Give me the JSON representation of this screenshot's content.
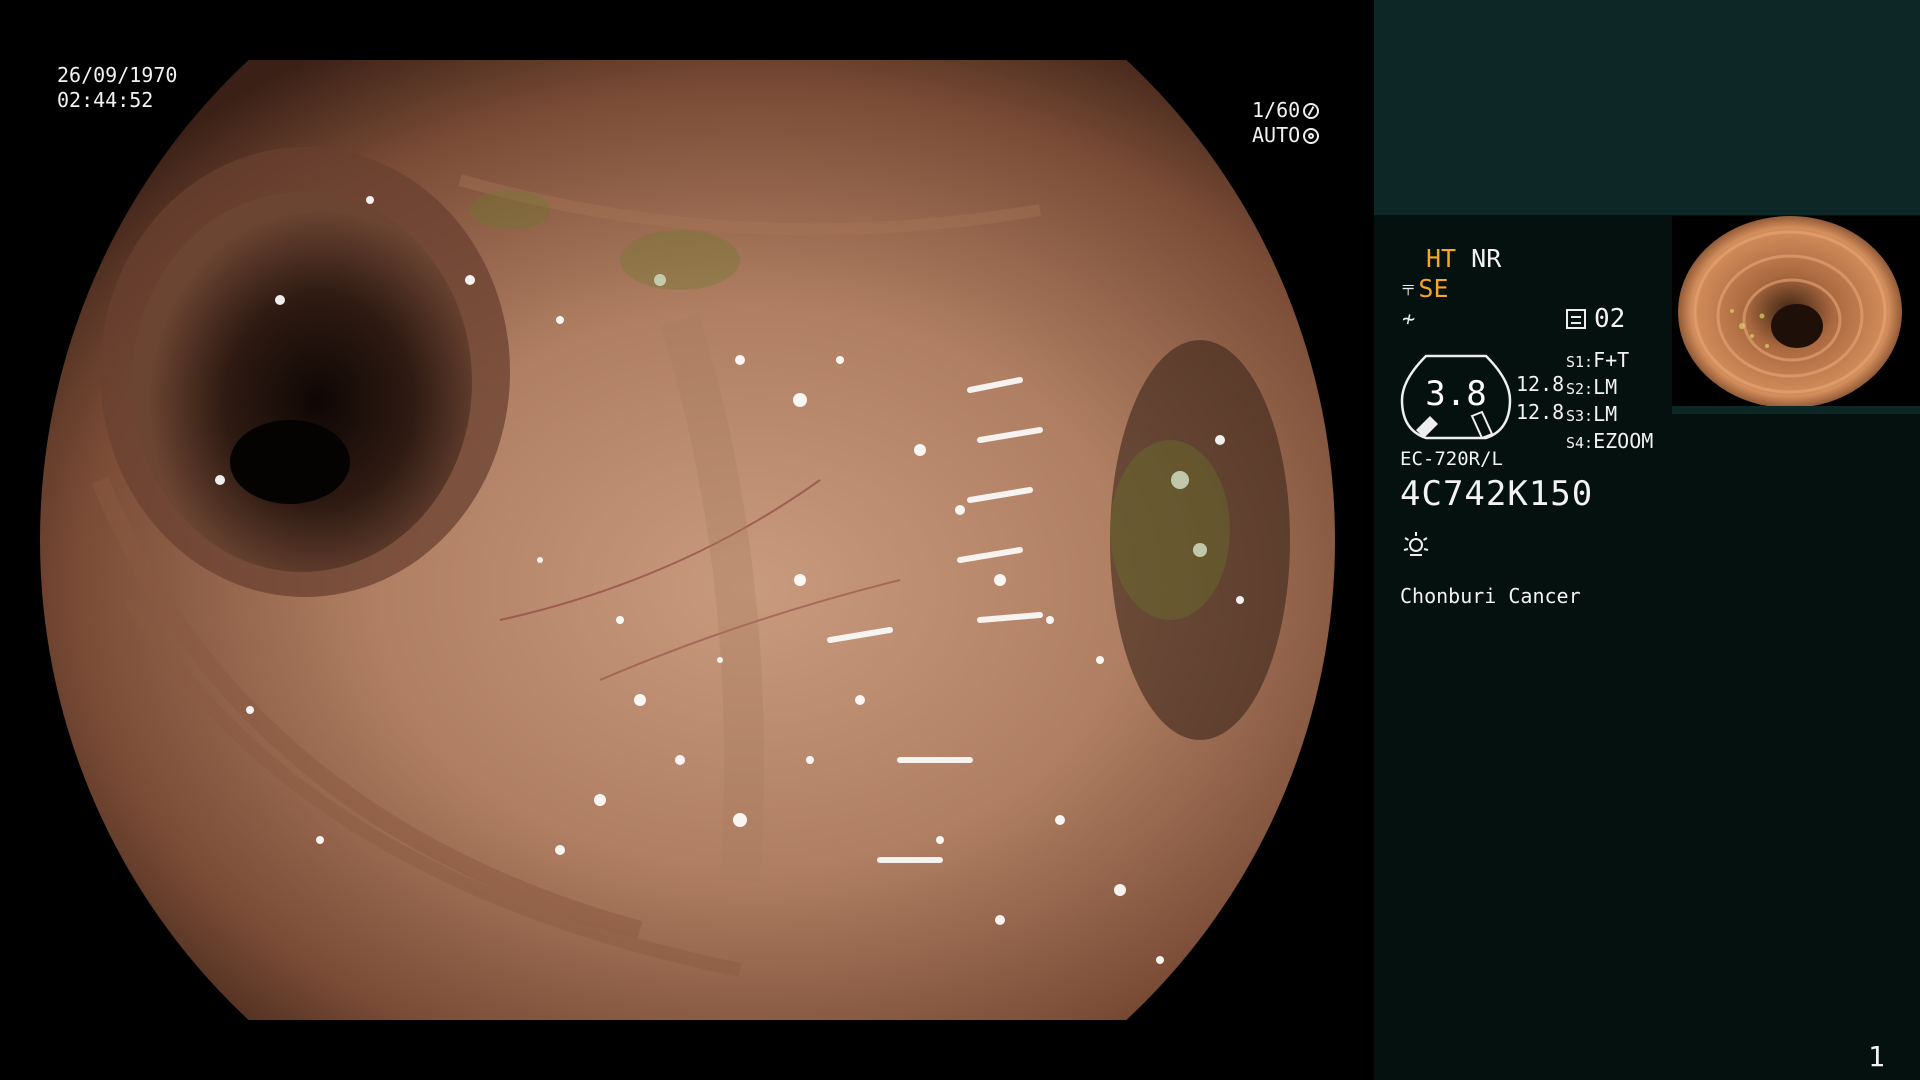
{
  "video": {
    "date": "26/09/1970",
    "time": "02:44:52",
    "shutter": "1/60",
    "iris": "AUTO"
  },
  "panel": {
    "ht": "HT",
    "nr": "NR",
    "se": "SE",
    "memory": "02",
    "gauge_value": "3.8",
    "thickness_1": "12.8",
    "thickness_2": "12.8",
    "settings": [
      {
        "key": "S1:",
        "value": "F+T"
      },
      {
        "key": "S2:",
        "value": "LM"
      },
      {
        "key": "S3:",
        "value": "LM"
      },
      {
        "key": "S4:",
        "value": "EZOOM"
      }
    ],
    "scope_model": "EC-720R/L",
    "serial": "4C742K150",
    "hospital": "Chonburi Cancer",
    "page_number": "1"
  },
  "colors": {
    "orange": "#f5a623",
    "panel_bg": "#04110f",
    "panel_top": "#0d2626"
  },
  "icons": [
    "shutter-icon",
    "iris-icon",
    "scope-icon",
    "flag-icon",
    "menu-icon",
    "light-icon"
  ]
}
